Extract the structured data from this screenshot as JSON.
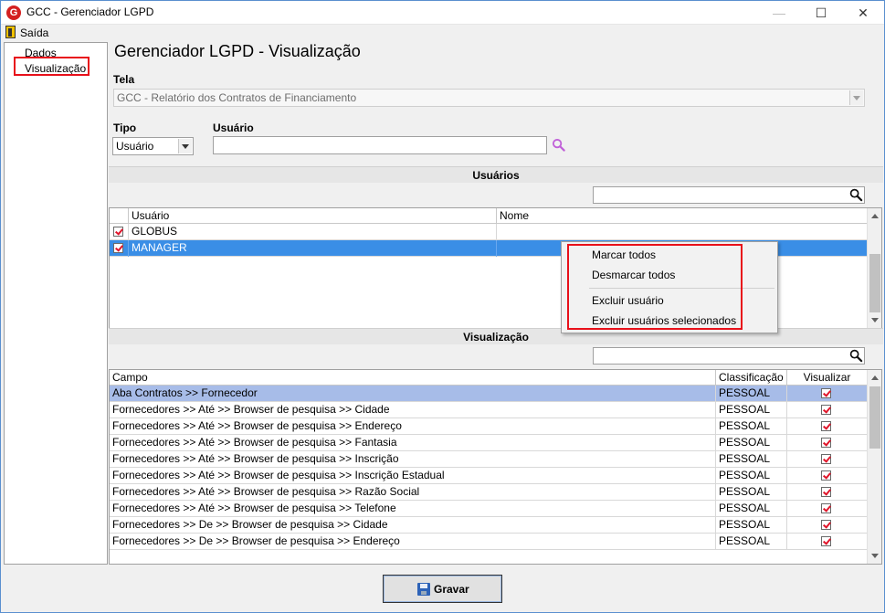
{
  "window": {
    "title": "GCC - Gerenciador LGPD",
    "app_icon_letter": "G"
  },
  "menu": {
    "exit_label": "Saída"
  },
  "tree": {
    "items": [
      "Dados",
      "Visualização"
    ],
    "selected": "Visualização"
  },
  "form": {
    "heading": "Gerenciador LGPD - Visualização",
    "tela_label": "Tela",
    "tela_value": "GCC - Relatório dos Contratos de Financiamento",
    "tipo_label": "Tipo",
    "tipo_value": "Usuário",
    "usuario_label": "Usuário",
    "usuario_value": ""
  },
  "users_section": {
    "title": "Usuários",
    "filter_value": "",
    "columns": [
      "Usuário",
      "Nome"
    ],
    "rows": [
      {
        "checked": true,
        "usuario": "GLOBUS",
        "nome": ""
      },
      {
        "checked": true,
        "usuario": "MANAGER",
        "nome": ""
      }
    ]
  },
  "context_menu": {
    "items": [
      "Marcar todos",
      "Desmarcar todos",
      "Excluir usuário",
      "Excluir usuários selecionados"
    ]
  },
  "view_section": {
    "title": "Visualização",
    "filter_value": "",
    "columns": [
      "Campo",
      "Classificação",
      "Visualizar"
    ],
    "rows": [
      {
        "campo": "Aba Contratos >> Fornecedor",
        "classificacao": "PESSOAL",
        "visualizar": true
      },
      {
        "campo": "Fornecedores >> Até >> Browser de pesquisa >> Cidade",
        "classificacao": "PESSOAL",
        "visualizar": true
      },
      {
        "campo": "Fornecedores >> Até >> Browser de pesquisa >> Endereço",
        "classificacao": "PESSOAL",
        "visualizar": true
      },
      {
        "campo": "Fornecedores >> Até >> Browser de pesquisa >> Fantasia",
        "classificacao": "PESSOAL",
        "visualizar": true
      },
      {
        "campo": "Fornecedores >> Até >> Browser de pesquisa >> Inscrição",
        "classificacao": "PESSOAL",
        "visualizar": true
      },
      {
        "campo": "Fornecedores >> Até >> Browser de pesquisa >> Inscrição Estadual",
        "classificacao": "PESSOAL",
        "visualizar": true
      },
      {
        "campo": "Fornecedores >> Até >> Browser de pesquisa >> Razão Social",
        "classificacao": "PESSOAL",
        "visualizar": true
      },
      {
        "campo": "Fornecedores >> Até >> Browser de pesquisa >> Telefone",
        "classificacao": "PESSOAL",
        "visualizar": true
      },
      {
        "campo": "Fornecedores >> De >> Browser de pesquisa >> Cidade",
        "classificacao": "PESSOAL",
        "visualizar": true
      },
      {
        "campo": "Fornecedores >> De >> Browser de pesquisa >> Endereço",
        "classificacao": "PESSOAL",
        "visualizar": true
      }
    ]
  },
  "footer": {
    "save_label": "Gravar"
  },
  "colors": {
    "highlight_border": "#e8101a",
    "selection_blue": "#3a8ee6",
    "selection_light": "#a7bce8",
    "check_red": "#e0152a"
  }
}
